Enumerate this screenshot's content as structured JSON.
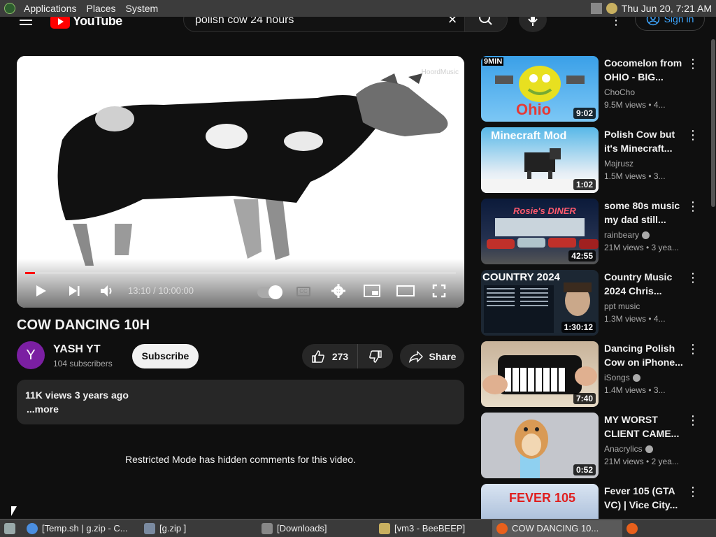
{
  "topbar": {
    "menus": [
      "Applications",
      "Places",
      "System"
    ],
    "clock": "Thu Jun 20,  7:21 AM"
  },
  "header": {
    "logo_text": "YouTube",
    "search_value": "polish cow 24 hours",
    "sign_in": "Sign in"
  },
  "player": {
    "time": "13:10 / 10:00:00",
    "progress_fraction": 0.022,
    "watermark": "HoordMusic"
  },
  "video": {
    "title": "COW DANCING 10H",
    "channel_initial": "Y",
    "channel_name": "YASH YT",
    "subscribers": "104 subscribers",
    "subscribe_label": "Subscribe",
    "likes": "273",
    "share_label": "Share",
    "views_age": "11K views  3 years ago",
    "more_label": "...more",
    "restricted_note": "Restricted Mode has hidden comments for this video."
  },
  "recommendations": [
    {
      "title": "Cocomelon from OHIO - BIG...",
      "channel": "ChoCho",
      "verified": false,
      "meta": "9.5M views • 4...",
      "duration": "9:02",
      "thumb_text": "Ohio",
      "thumb_badge": "9MIN"
    },
    {
      "title": "Polish Cow but it's Minecraft...",
      "channel": "Majrusz",
      "verified": false,
      "meta": "1.5M views • 3...",
      "duration": "1:02",
      "thumb_text": "Minecraft Mod"
    },
    {
      "title": "some 80s music my dad still...",
      "channel": "rainbeary",
      "verified": true,
      "meta": "21M views • 3 yea...",
      "duration": "42:55",
      "thumb_text": "Rosie's DINER"
    },
    {
      "title": "Country Music 2024 Chris...",
      "channel": "ppt music",
      "verified": false,
      "meta": "1.3M views • 4...",
      "duration": "1:30:12",
      "thumb_text": "COUNTRY 2024"
    },
    {
      "title": "Dancing Polish Cow on iPhone...",
      "channel": "iSongs",
      "verified": true,
      "meta": "1.4M views • 3...",
      "duration": "7:40"
    },
    {
      "title": "MY WORST CLIENT CAME...",
      "channel": "Anacrylics",
      "verified": true,
      "meta": "21M views • 2 yea...",
      "duration": "0:52"
    },
    {
      "title": "Fever 105 (GTA VC) | Vice City...",
      "channel": "",
      "verified": false,
      "meta": "",
      "duration": "",
      "thumb_text": "FEVER 105"
    }
  ],
  "taskbar": {
    "tasks": [
      "[Temp.sh | g.zip - C...",
      "[g.zip ]",
      "[Downloads]",
      "[vm3 - BeeBEEP]",
      "COW DANCING 10..."
    ]
  },
  "colors": {
    "background": "#0f0f0f",
    "accent_red": "#ff0000",
    "link_blue": "#3ea6ff"
  }
}
